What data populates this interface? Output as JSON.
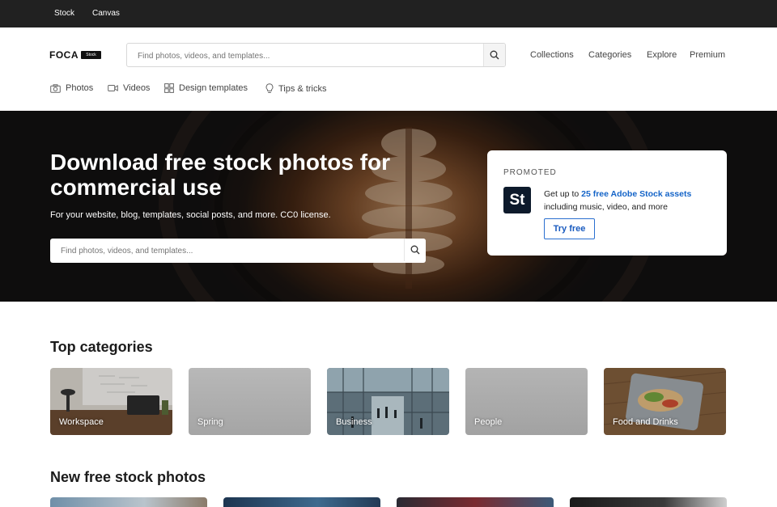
{
  "topbar": {
    "links": [
      "Stock",
      "Canvas"
    ]
  },
  "header": {
    "logo": "FOCA",
    "logo_badge": "Stock",
    "search_placeholder": "Find photos, videos, and templates...",
    "nav": [
      "Collections",
      "Categories",
      "Explore",
      "Premium"
    ]
  },
  "subnav": [
    {
      "label": "Photos",
      "icon": "camera-icon"
    },
    {
      "label": "Videos",
      "icon": "video-icon"
    },
    {
      "label": "Design templates",
      "icon": "grid-icon"
    },
    {
      "label": "Tips & tricks",
      "icon": "lightbulb-icon"
    }
  ],
  "hero": {
    "title": "Download free stock photos for commercial use",
    "subtitle": "For your website, blog, templates, social posts, and more. CC0 license.",
    "search_placeholder": "Find photos, videos, and templates..."
  },
  "promo": {
    "label": "PROMOTED",
    "logo_text": "St",
    "text_before": "Get up to ",
    "text_highlight": "25 free Adobe Stock assets",
    "text_after": "including music, video, and more",
    "button": "Try free",
    "accent_color": "#1464c8"
  },
  "top_categories": {
    "title": "Top categories",
    "items": [
      "Workspace",
      "Spring",
      "Business",
      "People",
      "Food and Drinks"
    ]
  },
  "new_photos": {
    "title": "New free stock photos"
  }
}
